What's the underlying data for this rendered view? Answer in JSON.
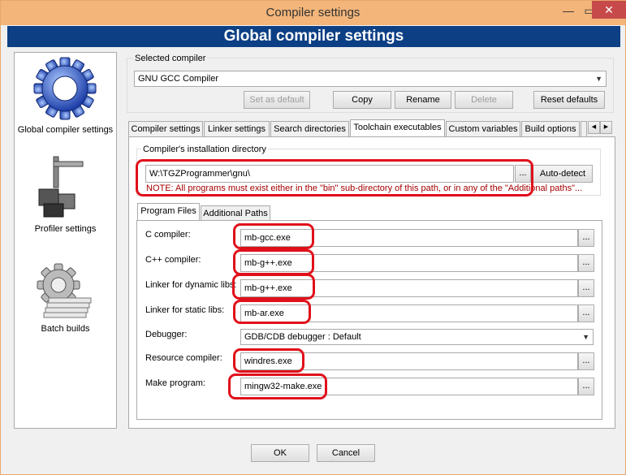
{
  "window": {
    "title": "Compiler settings",
    "header": "Global compiler settings",
    "controls": {
      "minimize": "—",
      "maximize": "▭",
      "close": "✕"
    }
  },
  "sidebar": {
    "items": [
      {
        "label": "Global compiler settings",
        "icon": "gear-icon"
      },
      {
        "label": "Profiler settings",
        "icon": "caliper-icon"
      },
      {
        "label": "Batch builds",
        "icon": "stack-gear-icon"
      }
    ]
  },
  "compiler": {
    "section_label": "Selected compiler",
    "selected": "GNU GCC Compiler",
    "buttons": {
      "set_default": "Set as default",
      "copy": "Copy",
      "rename": "Rename",
      "delete": "Delete",
      "reset": "Reset defaults"
    }
  },
  "tabs": [
    {
      "label": "Compiler settings"
    },
    {
      "label": "Linker settings"
    },
    {
      "label": "Search directories"
    },
    {
      "label": "Toolchain executables"
    },
    {
      "label": "Custom variables"
    },
    {
      "label": "Build options"
    },
    {
      "label": ""
    }
  ],
  "tab_scroll": {
    "left": "◀",
    "right": "▶"
  },
  "install_dir": {
    "group_label": "Compiler's installation directory",
    "value": "W:\\TGZProgrammer\\gnu\\",
    "browse": "...",
    "auto_detect": "Auto-detect",
    "note": "NOTE: All programs must exist either in the \"bin\" sub-directory of this path, or in any of the \"Additional paths\"..."
  },
  "subtabs": [
    {
      "label": "Program Files"
    },
    {
      "label": "Additional Paths"
    }
  ],
  "programs": [
    {
      "label": "C compiler:",
      "value": "mb-gcc.exe"
    },
    {
      "label": "C++ compiler:",
      "value": "mb-g++.exe"
    },
    {
      "label": "Linker for dynamic libs:",
      "value": "mb-g++.exe"
    },
    {
      "label": "Linker for static libs:",
      "value": "mb-ar.exe"
    },
    {
      "label": "Debugger:",
      "value": "GDB/CDB debugger : Default"
    },
    {
      "label": "Resource compiler:",
      "value": "windres.exe"
    },
    {
      "label": "Make program:",
      "value": "mingw32-make.exe"
    }
  ],
  "dialog_buttons": {
    "ok": "OK",
    "cancel": "Cancel"
  },
  "colors": {
    "header": "#0c3f84",
    "titlebar": "#f3b57a",
    "highlight": "#e0101a",
    "note": "#a40000"
  }
}
